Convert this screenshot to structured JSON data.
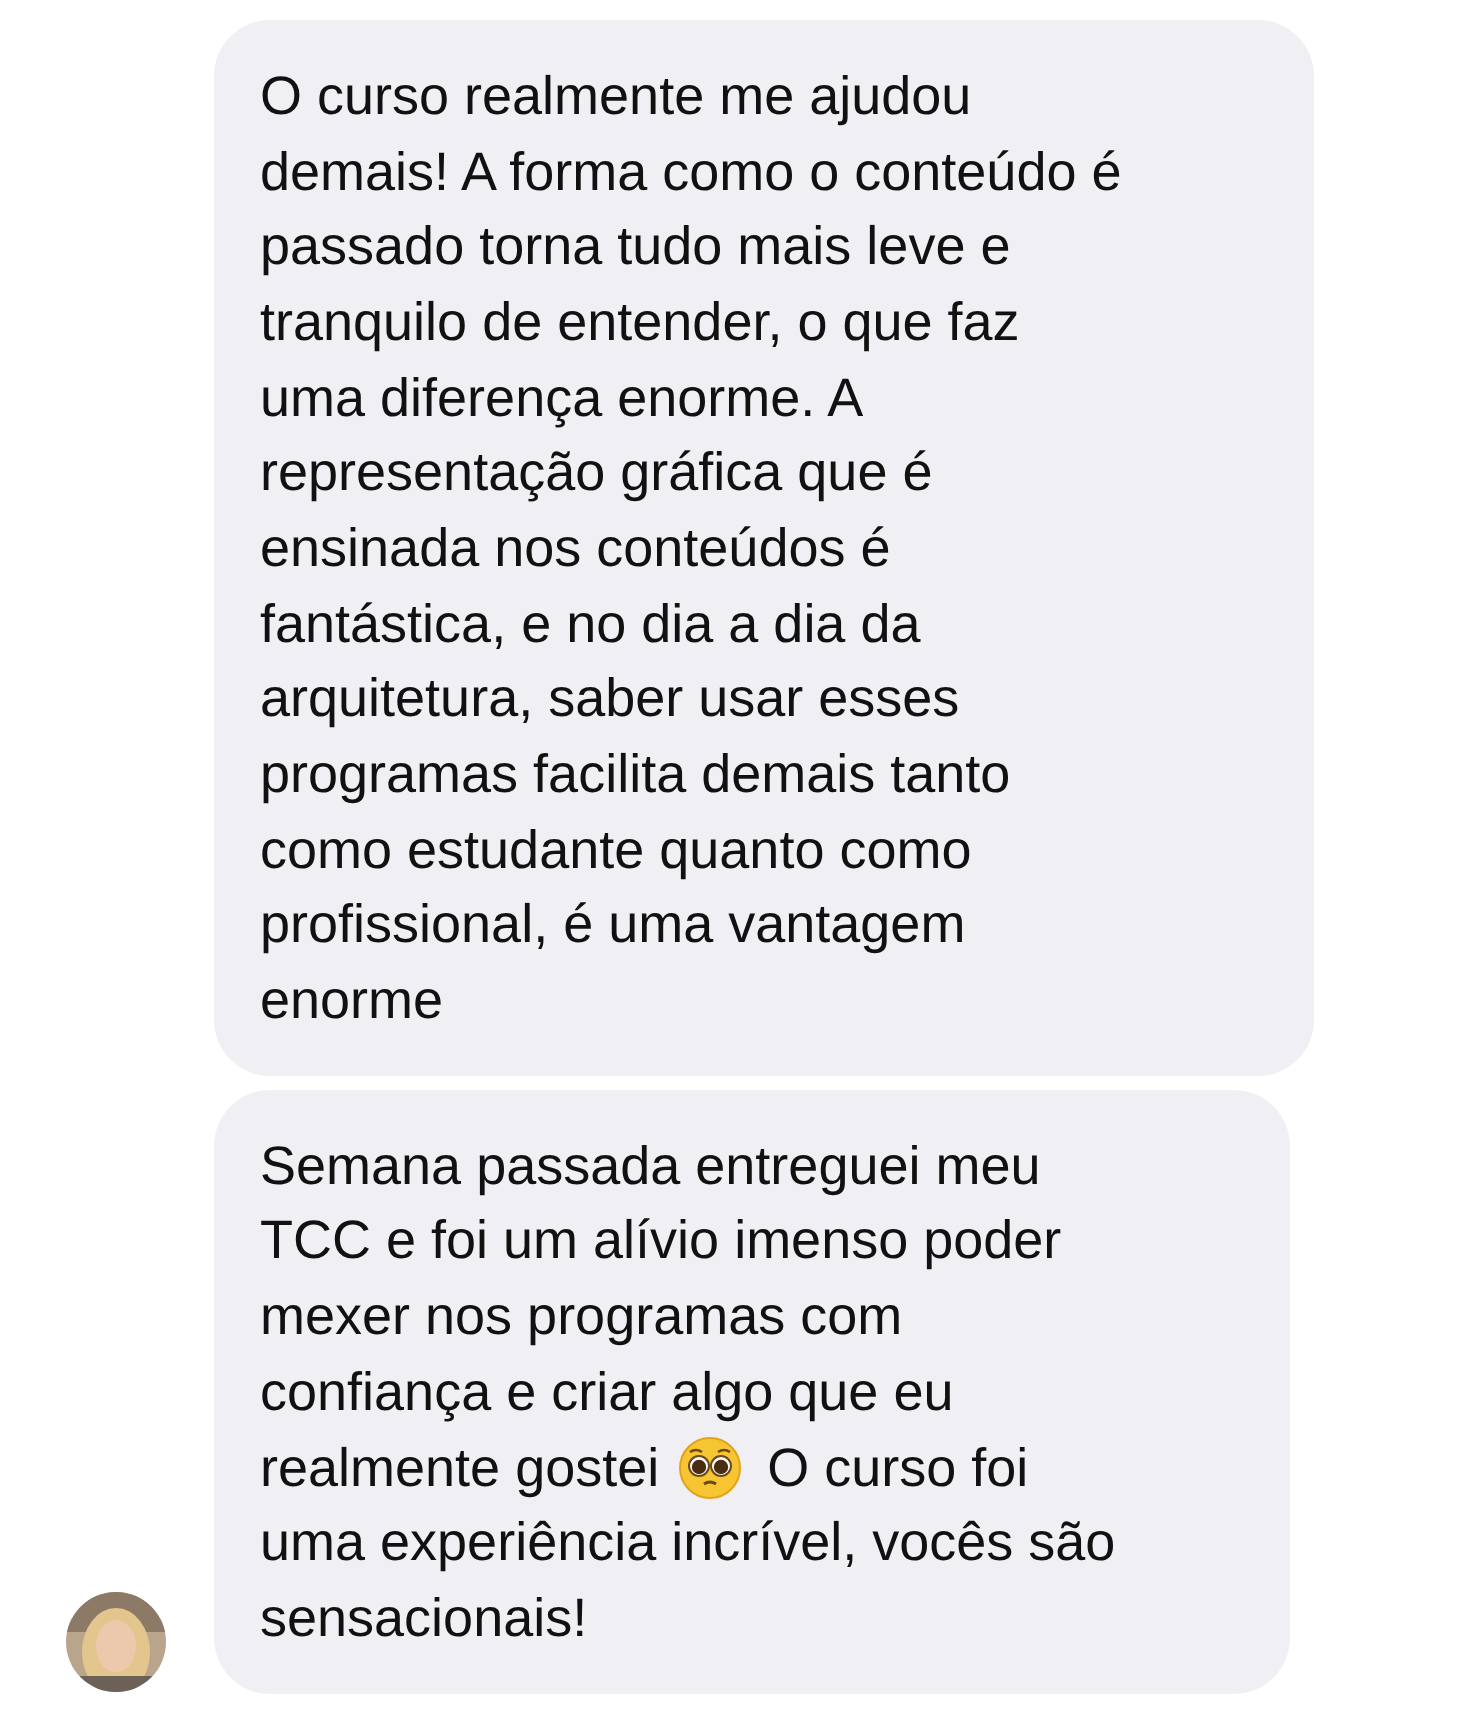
{
  "messages": [
    {
      "lines": [
        {
          "kind": "text",
          "text": "O curso realmente me ajudou"
        },
        {
          "kind": "text",
          "text": "demais! A forma como o conteúdo é"
        },
        {
          "kind": "text",
          "text": "passado torna tudo mais leve e"
        },
        {
          "kind": "text",
          "text": "tranquilo de entender, o que faz"
        },
        {
          "kind": "text",
          "text": "uma diferença enorme. A"
        },
        {
          "kind": "text",
          "text": "representação gráfica que é"
        },
        {
          "kind": "text",
          "text": "ensinada nos conteúdos é"
        },
        {
          "kind": "text",
          "text": "fantástica, e no dia a dia da"
        },
        {
          "kind": "text",
          "text": "arquitetura, saber usar esses"
        },
        {
          "kind": "text",
          "text": "programas facilita demais tanto"
        },
        {
          "kind": "text",
          "text": "como estudante quanto como"
        },
        {
          "kind": "text",
          "text": "profissional, é uma vantagem"
        },
        {
          "kind": "text",
          "text": "enorme"
        }
      ]
    },
    {
      "lines": [
        {
          "kind": "text",
          "text": "Semana passada entreguei meu"
        },
        {
          "kind": "text",
          "text": "TCC e foi um alívio imenso poder"
        },
        {
          "kind": "text",
          "text": "mexer nos programas com"
        },
        {
          "kind": "text",
          "text": "confiança e criar algo que eu"
        },
        {
          "kind": "emoji",
          "before": "realmente gostei",
          "after": "O curso foi"
        },
        {
          "kind": "text",
          "text": "uma experiência incrível, vocês são"
        },
        {
          "kind": "text",
          "text": "sensacionais!"
        }
      ],
      "avatar": true
    }
  ]
}
